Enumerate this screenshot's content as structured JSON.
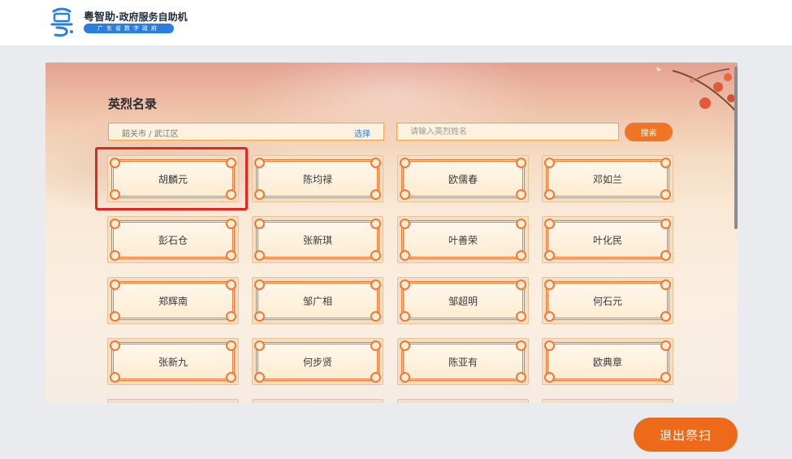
{
  "header": {
    "brand_name": "粤智助",
    "brand_tagline": "·政府服务自助机",
    "brand_subtitle": "广东省数字政府",
    "logo_icon": "yue-character-logo-icon"
  },
  "page": {
    "title": "英烈名录",
    "region": {
      "value": "韶关市 / 武江区",
      "select_label": "选择"
    },
    "search": {
      "placeholder": "请输入英烈姓名",
      "button_label": "搜索"
    },
    "names": [
      [
        "胡麟元",
        "陈均禄",
        "欧儒春",
        "邓如兰"
      ],
      [
        "彭石仓",
        "张新琪",
        "叶善荣",
        "叶化民"
      ],
      [
        "郑辉南",
        "邹广相",
        "邹超明",
        "何石元"
      ],
      [
        "张新九",
        "何步贤",
        "陈亚有",
        "欧典章"
      ]
    ],
    "highlighted_name": "胡麟元"
  },
  "footer": {
    "exit_label": "退出祭扫"
  },
  "colors": {
    "accent": "#ef7423",
    "brand_blue": "#2a7ee0",
    "highlight_red": "#e3261f"
  }
}
